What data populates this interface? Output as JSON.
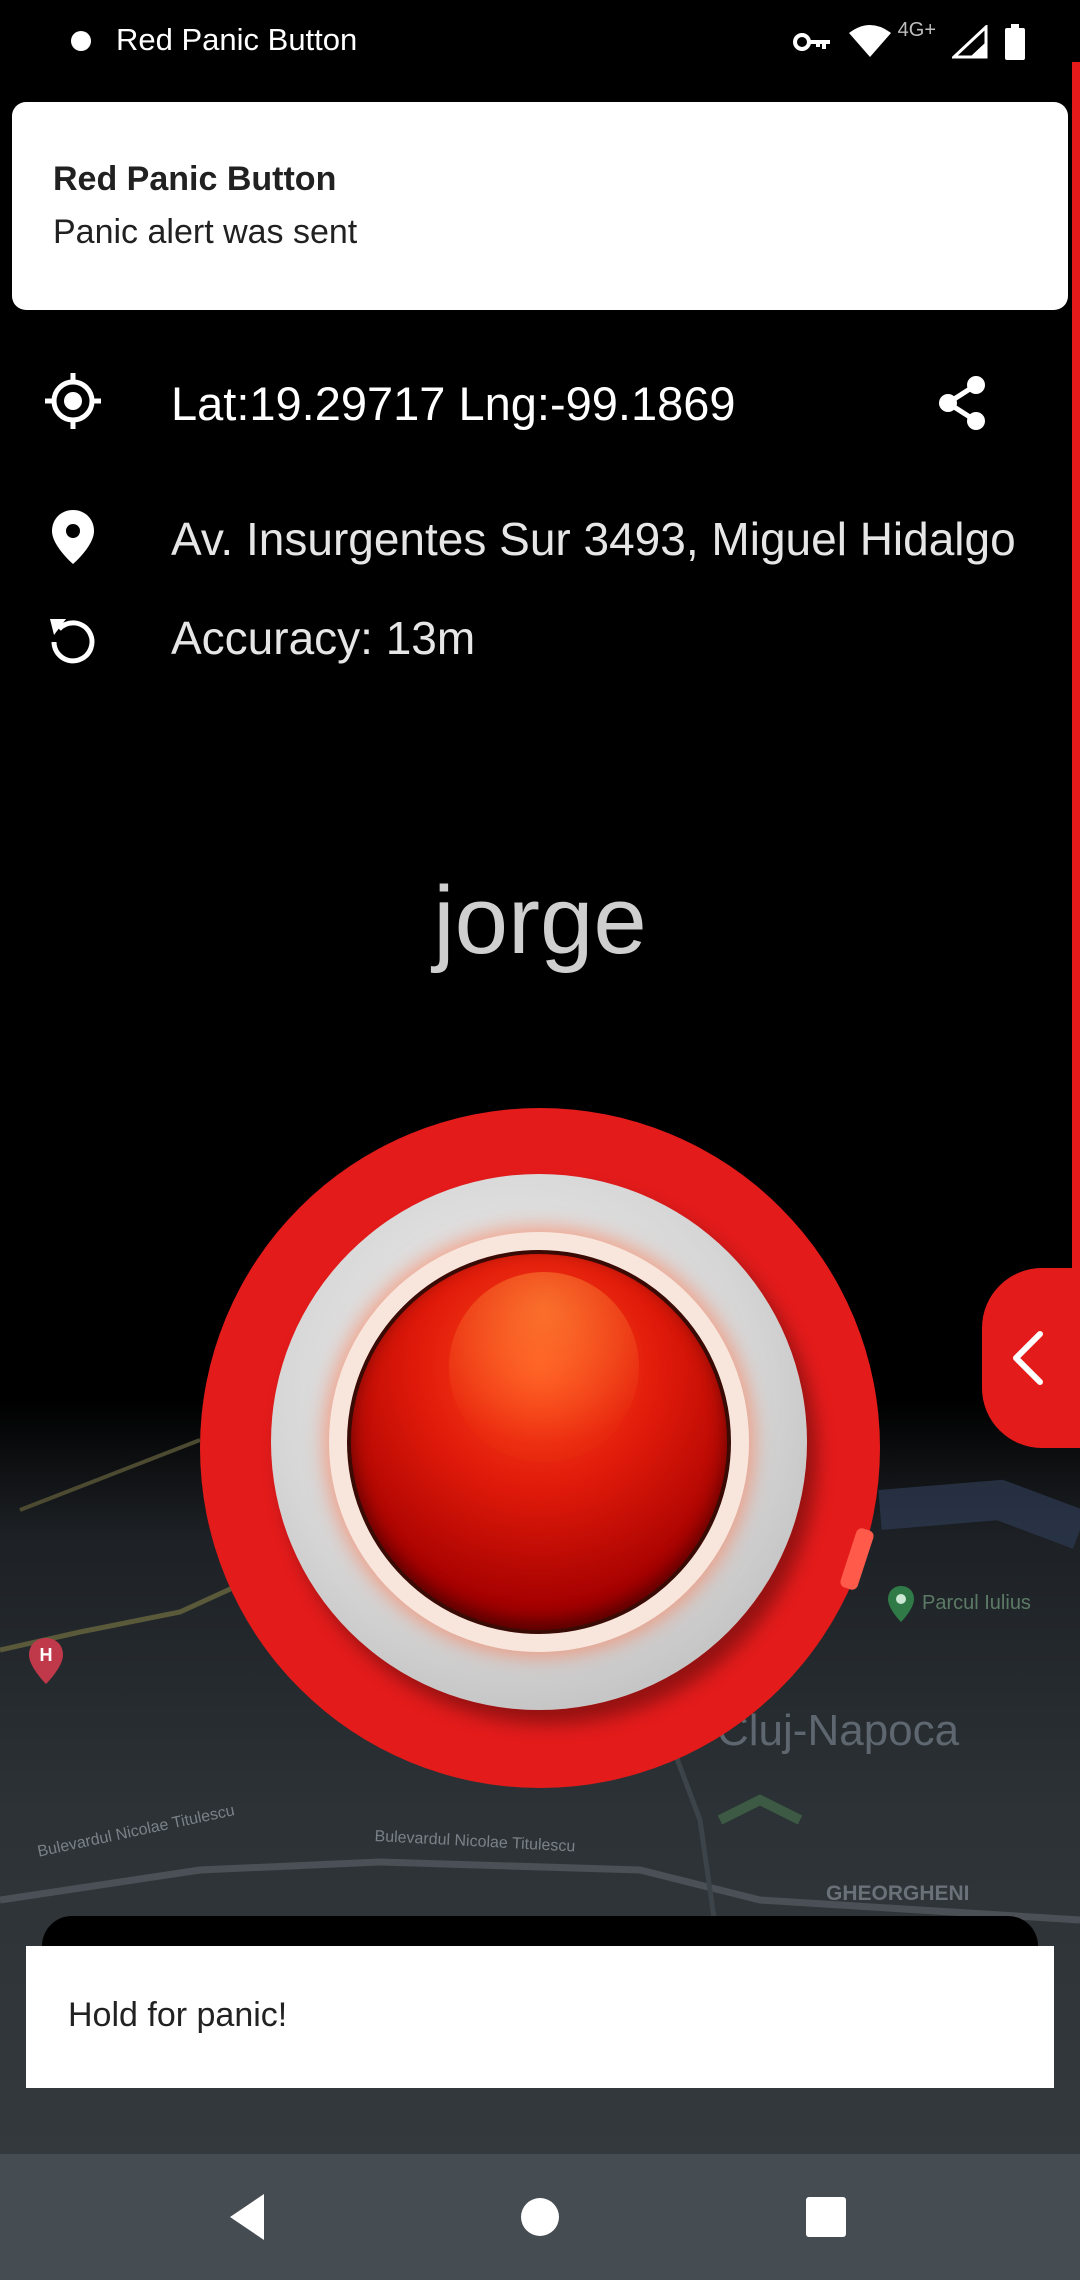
{
  "status_bar": {
    "app_name": "Red Panic Button",
    "network_label": "4G+"
  },
  "notification": {
    "title": "Red Panic Button",
    "text": "Panic alert was sent"
  },
  "location": {
    "coordinates": "Lat:19.29717 Lng:-99.1869",
    "address": "Av. Insurgentes Sur 3493, Miguel Hidalgo",
    "accuracy": "Accuracy: 13m"
  },
  "user": {
    "name": "jorge"
  },
  "map": {
    "city": "Cluj-Napoca",
    "district": "GHEORGHENI",
    "park": "Parcul Iulius",
    "street_1": "Bulevardul Nicolae Titulescu",
    "street_2": "Bulevardul Nicolae Titulescu"
  },
  "toast": {
    "text": "Hold for panic!"
  },
  "colors": {
    "accent_red": "#e31b1b",
    "nav_bar": "#454c52"
  },
  "icons": {
    "gps": "crosshair-icon",
    "place": "location-pin-icon",
    "accuracy": "refresh-icon",
    "share": "share-icon",
    "drawer": "chevron-left-icon"
  }
}
